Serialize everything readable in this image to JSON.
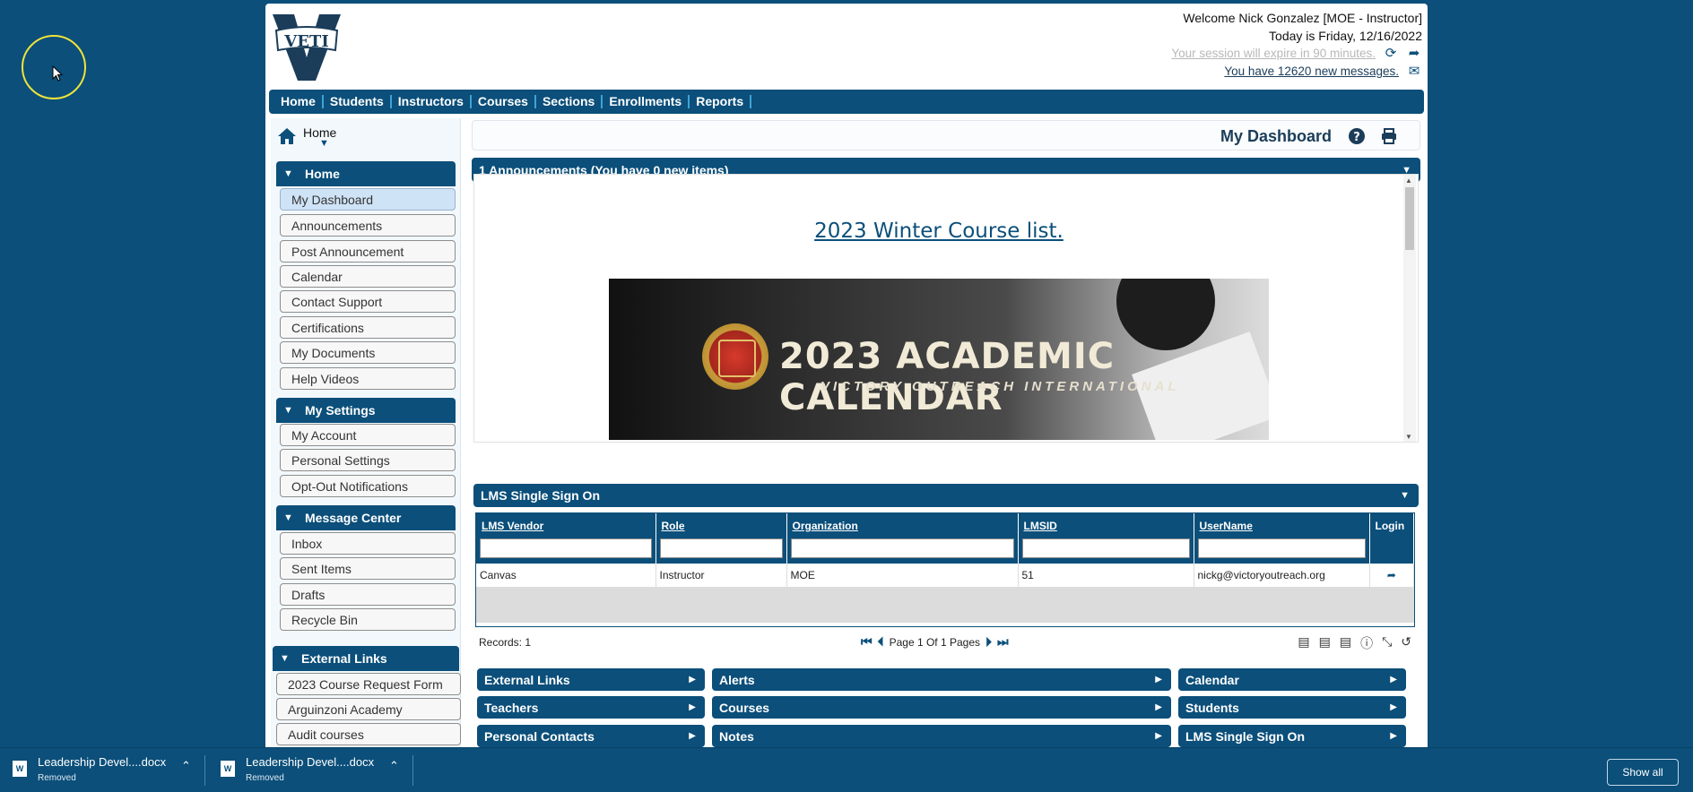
{
  "header": {
    "welcome": "Welcome Nick Gonzalez [MOE - Instructor]",
    "date": "Today is Friday, 12/16/2022",
    "session": "Your session will expire in 90 minutes.",
    "messages": "You have 12620 new messages."
  },
  "nav": [
    "Home",
    "Students",
    "Instructors",
    "Courses",
    "Sections",
    "Enrollments",
    "Reports"
  ],
  "breadcrumb": "Home",
  "sidebar": {
    "home": {
      "title": "Home",
      "items": [
        "My Dashboard",
        "Announcements",
        "Post Announcement",
        "Calendar",
        "Contact Support",
        "Certifications",
        "My Documents",
        "Help Videos"
      ]
    },
    "settings": {
      "title": "My Settings",
      "items": [
        "My Account",
        "Personal Settings",
        "Opt-Out Notifications"
      ]
    },
    "messages": {
      "title": "Message Center",
      "items": [
        "Inbox",
        "Sent Items",
        "Drafts",
        "Recycle Bin"
      ]
    },
    "external": {
      "title": "External Links",
      "items": [
        "2023 Course Request Form",
        "Arguinzoni Academy",
        "Audit courses"
      ]
    }
  },
  "dashboard": {
    "title": "My Dashboard"
  },
  "announcements": {
    "header": "1 Announcements (You have 0 new items)",
    "link": "2023 Winter Course list.",
    "banner_title": "2023 ACADEMIC CALENDAR",
    "banner_sub": "VICTORY OUTREACH INTERNATIONAL"
  },
  "lms": {
    "header": "LMS Single Sign On",
    "columns": [
      "LMS Vendor",
      "Role",
      "Organization",
      "LMSID",
      "UserName",
      "Login"
    ],
    "rows": [
      [
        "Canvas",
        "Instructor",
        "MOE",
        "51",
        "nickg@victoryoutreach.org"
      ]
    ],
    "records": "Records: 1",
    "page_info": "Page 1 Of 1 Pages"
  },
  "widgets": [
    "External Links",
    "Alerts",
    "Calendar",
    "Teachers",
    "Courses",
    "Students",
    "Personal Contacts",
    "Notes",
    "LMS Single Sign On"
  ],
  "downloads": [
    {
      "name": "Leadership Devel....docx",
      "status": "Removed"
    },
    {
      "name": "Leadership Devel....docx",
      "status": "Removed"
    }
  ],
  "show_all": "Show all",
  "colors": {
    "brand": "#0b4f7a",
    "accent": "#3fa3d6"
  }
}
